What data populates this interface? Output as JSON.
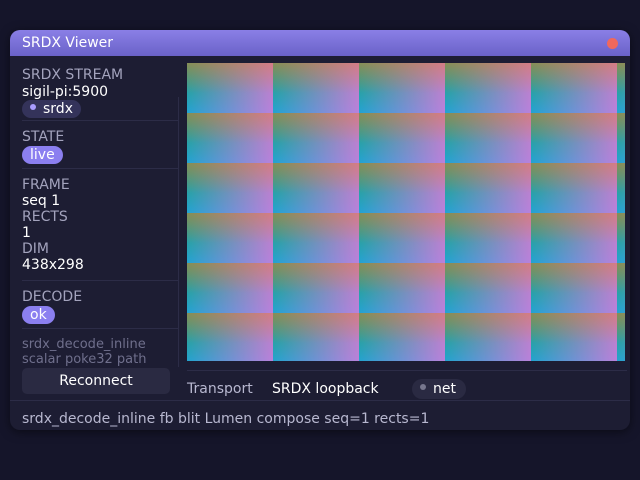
{
  "window": {
    "title": "SRDX Viewer"
  },
  "sidebar": {
    "stream_label": "SRDX STREAM",
    "stream_value": "sigil-pi:5900",
    "stream_tag": "srdx",
    "state_label": "STATE",
    "state_value": "live",
    "frame_label": "FRAME",
    "frame_value": "seq 1",
    "rects_label": "RECTS",
    "rects_value": "1",
    "dim_label": "DIM",
    "dim_value": "438x298",
    "decode_label": "DECODE",
    "decode_value": "ok",
    "note_line1": "srdx_decode_inline",
    "note_line2": "scalar poke32 path",
    "reconnect_label": "Reconnect"
  },
  "transport": {
    "label": "Transport",
    "value": "SRDX loopback",
    "badge": "net"
  },
  "status_bar": "srdx_decode_inline  fb blit  Lumen compose  seq=1  rects=1",
  "colors": {
    "titlebar": "#7a71db",
    "accent": "#8b7ff0",
    "close": "#f0685c"
  }
}
